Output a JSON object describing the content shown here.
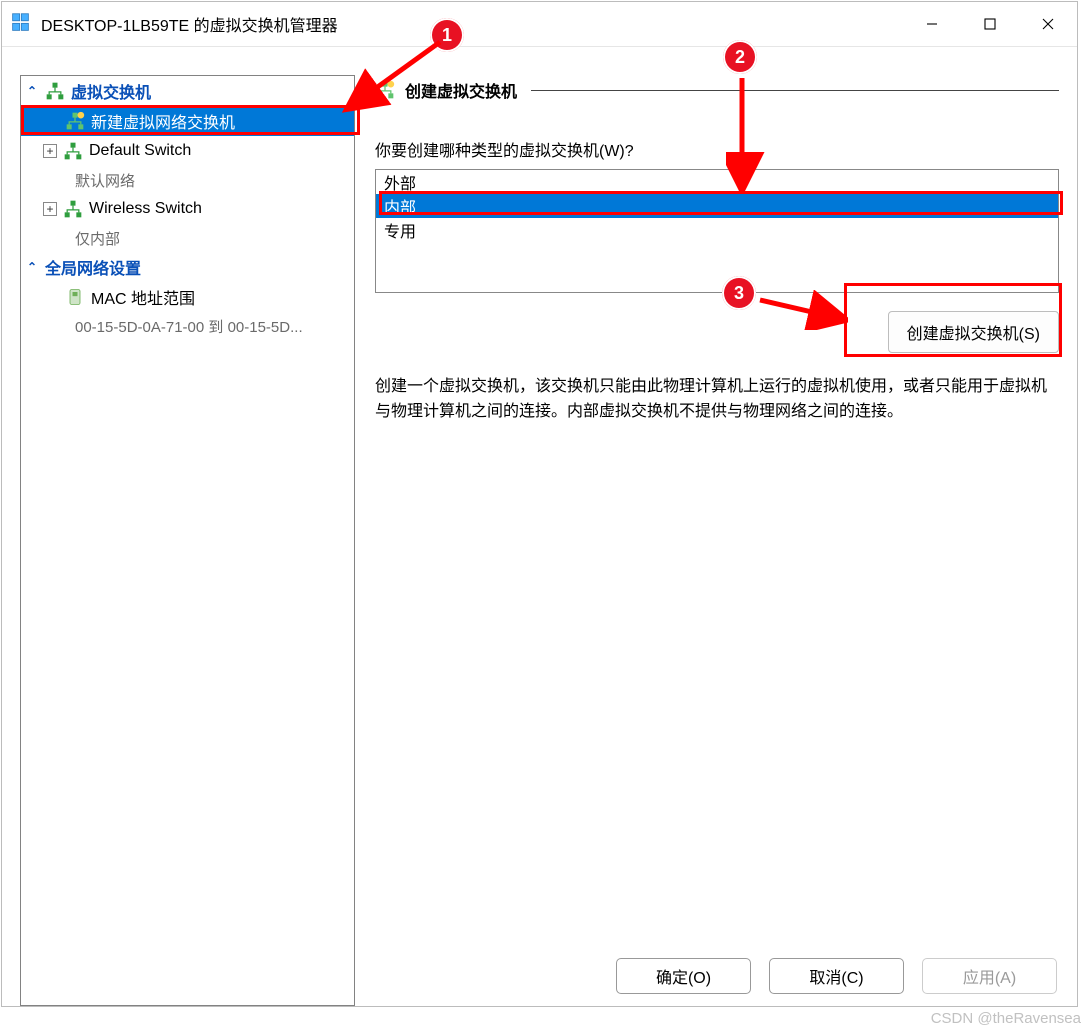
{
  "window": {
    "title": "DESKTOP-1LB59TE 的虚拟交换机管理器"
  },
  "sidebar": {
    "cat_switches": "虚拟交换机",
    "new_switch": "新建虚拟网络交换机",
    "items": [
      {
        "name": "Default Switch",
        "sub": "默认网络"
      },
      {
        "name": "Wireless Switch",
        "sub": "仅内部"
      }
    ],
    "cat_global": "全局网络设置",
    "mac": {
      "name": "MAC 地址范围",
      "range": "00-15-5D-0A-71-00 到 00-15-5D..."
    }
  },
  "main": {
    "section_title": "创建虚拟交换机",
    "question": "你要创建哪种类型的虚拟交换机(W)?",
    "options": [
      "外部",
      "内部",
      "专用"
    ],
    "selected_index": 1,
    "create_button": "创建虚拟交换机(S)",
    "description": "创建一个虚拟交换机，该交换机只能由此物理计算机上运行的虚拟机使用，或者只能用于虚拟机与物理计算机之间的连接。内部虚拟交换机不提供与物理网络之间的连接。"
  },
  "buttons": {
    "ok": "确定(O)",
    "cancel": "取消(C)",
    "apply": "应用(A)"
  },
  "annotations": {
    "b1": "1",
    "b2": "2",
    "b3": "3"
  },
  "watermark": "CSDN @theRavensea"
}
